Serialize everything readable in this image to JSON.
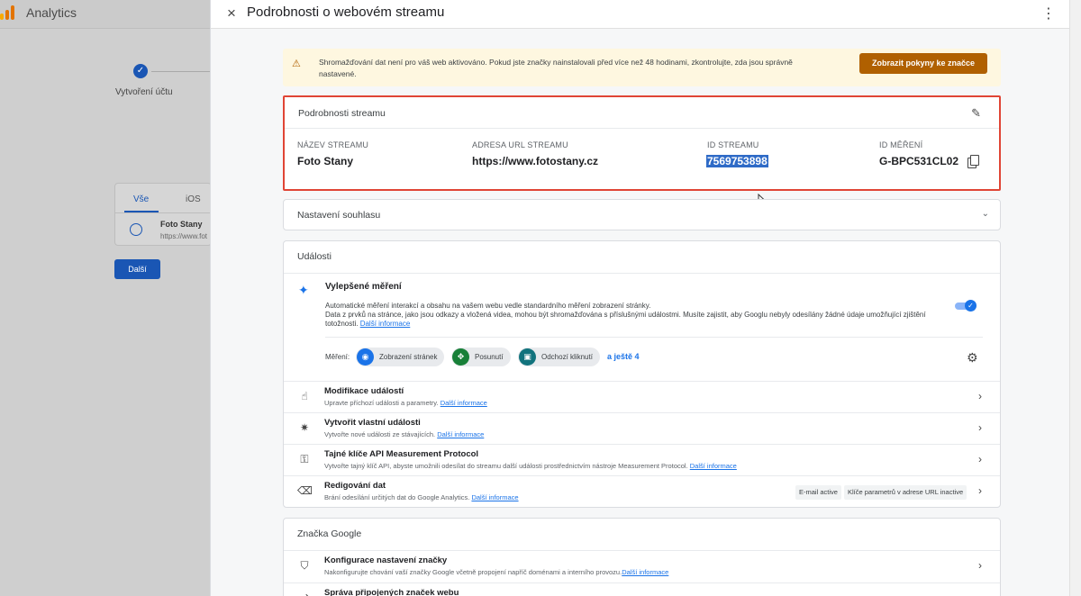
{
  "background_app": {
    "title": "Analytics",
    "step_check": "✓",
    "step_label": "Vytvoření účtu",
    "tabs": [
      "Vše",
      "iOS"
    ],
    "stream_name": "Foto Stany",
    "stream_url": "https://www.fot",
    "next_button": "Další",
    "logo_colors": [
      "#f9ab00",
      "#e37400",
      "#e37400"
    ]
  },
  "panel": {
    "close_icon": "×",
    "title": "Podrobnosti o webovém streamu",
    "more_icon": "⋮"
  },
  "warning": {
    "icon": "⚠",
    "text": "Shromažďování dat není pro váš web aktivováno. Pokud jste značky nainstalovali před více než 48 hodinami, zkontrolujte, zda jsou správně nastavené.",
    "button": "Zobrazit pokyny ke značce"
  },
  "stream_details": {
    "title": "Podrobnosti streamu",
    "edit_icon": "✎",
    "fields": [
      {
        "label": "NÁZEV STREAMU",
        "value": "Foto Stany"
      },
      {
        "label": "ADRESA URL STREAMU",
        "value": "https://www.fotostany.cz"
      },
      {
        "label": "ID STREAMU",
        "value": "7569753898"
      },
      {
        "label": "ID MĚŘENÍ",
        "value": "G-BPC531CL02"
      }
    ]
  },
  "consent": {
    "title": "Nastavení souhlasu",
    "chevron": "⌄"
  },
  "events": {
    "title": "Události",
    "enhanced": {
      "icon": "✦",
      "title": "Vylepšené měření",
      "desc_line1": "Automatické měření interakcí a obsahu na vašem webu vedle standardního měření zobrazení stránky.",
      "desc_line2": "Data z prvků na stránce, jako jsou odkazy a vložená videa, mohou být shromažďována s příslušnými událostmi. Musíte zajistit, aby Googlu nebyly odesílány žádné údaje umožňující zjištění totožnosti.",
      "link": "Další informace",
      "toggle_on": true,
      "toggle_check": "✓"
    },
    "measurement_label": "Měření:",
    "chips": [
      {
        "label": "Zobrazení stránek",
        "icon": "◉",
        "color": "#1a73e8"
      },
      {
        "label": "Posunutí",
        "icon": "✥",
        "color": "#188038"
      },
      {
        "label": "Odchozí kliknutí",
        "icon": "▣",
        "color": "#12737d"
      }
    ],
    "more_link": "a ještě 4",
    "settings_icon": "⚙",
    "rows": [
      {
        "icon": "☝",
        "title": "Modifikace událostí",
        "sub": "Upravte příchozí události a parametry.",
        "link": "Další informace",
        "chevron": "›"
      },
      {
        "icon": "✷",
        "title": "Vytvořit vlastní události",
        "sub": "Vytvořte nové události ze stávajících.",
        "link": "Další informace",
        "chevron": "›"
      },
      {
        "icon": "⚿",
        "title": "Tajné klíče API Measurement Protocol",
        "sub": "Vytvořte tajný klíč API, abyste umožnili odesílat do streamu další události prostřednictvím nástroje Measurement Protocol.",
        "link": "Další informace",
        "chevron": "›"
      },
      {
        "icon": "⌫",
        "title": "Redigování dat",
        "sub": "Brání odesílání určitých dat do Google Analytics.",
        "link": "Další informace",
        "chevron": "›"
      }
    ],
    "redaction_badges": [
      "E-mail active",
      "Klíče parametrů v adrese URL inactive"
    ]
  },
  "google_tag": {
    "title": "Značka Google",
    "rows": [
      {
        "icon": "⛉",
        "title": "Konfigurace nastavení značky",
        "sub": "Nakonfigurujte chování vaší značky Google včetně propojení napříč doménami a interního provozu.",
        "link": "Další informace",
        "chevron": "›"
      },
      {
        "icon": "⇄",
        "title": "Správa připojených značek webu",
        "sub": "",
        "link": "",
        "chevron": "›"
      }
    ]
  }
}
